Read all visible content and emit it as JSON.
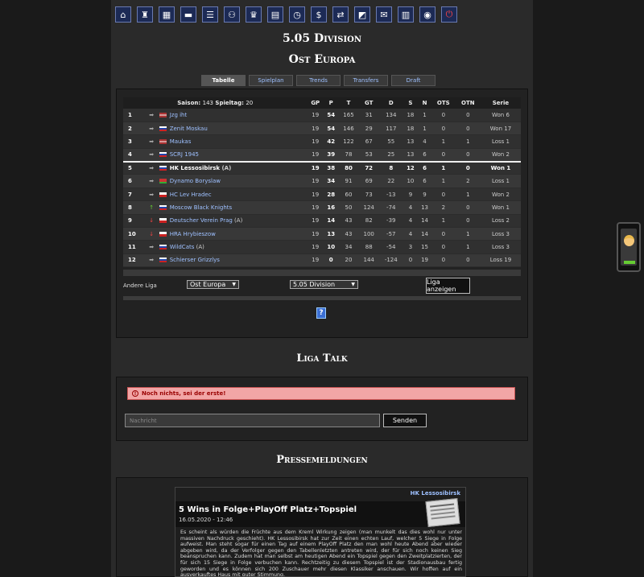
{
  "nav_icons": [
    "home-icon",
    "jersey-icon",
    "lineup-icon",
    "training-icon",
    "list-icon",
    "versus-icon",
    "trophy-icon",
    "arena-icon",
    "clock-icon",
    "finance-icon",
    "transfer-icon",
    "stats-icon",
    "mail-icon",
    "table-icon",
    "chat-icon",
    "logout-icon"
  ],
  "division_title": "5.05 Division",
  "region_title": "Ost Europa",
  "tabs": [
    "Tabelle",
    "Spielplan",
    "Trends",
    "Transfers",
    "Draft"
  ],
  "table": {
    "season_label": "Saison:",
    "season_value": "143",
    "matchday_label": "Spieltag:",
    "matchday_value": "20",
    "columns": [
      "GP",
      "P",
      "T",
      "GT",
      "D",
      "S",
      "N",
      "OTS",
      "OTN",
      "Serie"
    ],
    "rows": [
      {
        "rank": "1",
        "trend": "same",
        "flag": "lv",
        "team": "Jzg iht",
        "suffix": "",
        "gp": "19",
        "p": "54",
        "t": "165",
        "gt": "31",
        "d": "134",
        "s": "18",
        "n": "1",
        "ots": "0",
        "otn": "0",
        "serie": "Won 6"
      },
      {
        "rank": "2",
        "trend": "same",
        "flag": "ru",
        "team": "Zenit Moskau",
        "suffix": "",
        "gp": "19",
        "p": "54",
        "t": "146",
        "gt": "29",
        "d": "117",
        "s": "18",
        "n": "1",
        "ots": "0",
        "otn": "0",
        "serie": "Won 17"
      },
      {
        "rank": "3",
        "trend": "same",
        "flag": "lv",
        "team": "Maukas",
        "suffix": "",
        "gp": "19",
        "p": "42",
        "t": "122",
        "gt": "67",
        "d": "55",
        "s": "13",
        "n": "4",
        "ots": "1",
        "otn": "1",
        "serie": "Loss 1"
      },
      {
        "rank": "4",
        "trend": "same",
        "flag": "ru",
        "team": "SCRJ 1945",
        "suffix": "",
        "gp": "19",
        "p": "39",
        "t": "78",
        "gt": "53",
        "d": "25",
        "s": "13",
        "n": "6",
        "ots": "0",
        "otn": "0",
        "serie": "Won 2"
      },
      {
        "rank": "5",
        "trend": "same",
        "flag": "ru",
        "team": "HK Lessosibirsk",
        "suffix": "(A)",
        "gp": "19",
        "p": "38",
        "t": "80",
        "gt": "72",
        "d": "8",
        "s": "12",
        "n": "6",
        "ots": "1",
        "otn": "0",
        "serie": "Won 1"
      },
      {
        "rank": "6",
        "trend": "same",
        "flag": "by",
        "team": "Dynamo Boryslaw",
        "suffix": "",
        "gp": "19",
        "p": "34",
        "t": "91",
        "gt": "69",
        "d": "22",
        "s": "10",
        "n": "6",
        "ots": "1",
        "otn": "2",
        "serie": "Loss 1"
      },
      {
        "rank": "7",
        "trend": "same",
        "flag": "cz",
        "team": "HC Lev Hradec",
        "suffix": "",
        "gp": "19",
        "p": "28",
        "t": "60",
        "gt": "73",
        "d": "-13",
        "s": "9",
        "n": "9",
        "ots": "0",
        "otn": "1",
        "serie": "Won 2"
      },
      {
        "rank": "8",
        "trend": "up",
        "flag": "ru",
        "team": "Moscow Black Knights",
        "suffix": "",
        "gp": "19",
        "p": "16",
        "t": "50",
        "gt": "124",
        "d": "-74",
        "s": "4",
        "n": "13",
        "ots": "2",
        "otn": "0",
        "serie": "Won 1"
      },
      {
        "rank": "9",
        "trend": "down",
        "flag": "cz",
        "team": "Deutscher Verein Prag",
        "suffix": "(A)",
        "gp": "19",
        "p": "14",
        "t": "43",
        "gt": "82",
        "d": "-39",
        "s": "4",
        "n": "14",
        "ots": "1",
        "otn": "0",
        "serie": "Loss 2"
      },
      {
        "rank": "10",
        "trend": "down",
        "flag": "cz",
        "team": "HRA Hrybieszow",
        "suffix": "",
        "gp": "19",
        "p": "13",
        "t": "43",
        "gt": "100",
        "d": "-57",
        "s": "4",
        "n": "14",
        "ots": "0",
        "otn": "1",
        "serie": "Loss 3"
      },
      {
        "rank": "11",
        "trend": "same",
        "flag": "ru",
        "team": "WildCats",
        "suffix": "(A)",
        "gp": "19",
        "p": "10",
        "t": "34",
        "gt": "88",
        "d": "-54",
        "s": "3",
        "n": "15",
        "ots": "0",
        "otn": "1",
        "serie": "Loss 3"
      },
      {
        "rank": "12",
        "trend": "same",
        "flag": "ru",
        "team": "Schierser Grizzlys",
        "suffix": "",
        "gp": "19",
        "p": "0",
        "t": "20",
        "gt": "144",
        "d": "-124",
        "s": "0",
        "n": "19",
        "ots": "0",
        "otn": "0",
        "serie": "Loss 19"
      }
    ]
  },
  "filter": {
    "label": "Andere Liga",
    "league_value": "Ost Europa",
    "division_value": "5.05 Division",
    "button": "Liga anzeigen"
  },
  "help_label": "?",
  "talk": {
    "title": "Liga Talk",
    "alert": "Noch nichts, sei der erste!",
    "placeholder": "Nachricht",
    "send_button": "Senden"
  },
  "press": {
    "title": "Pressemeldungen",
    "team": "HK Lessosibirsk",
    "headline": "5 Wins in Folge+PlayOff Platz+Topspiel",
    "date": "16.05.2020 - 12:46",
    "body": "Es scheint als würden die Früchte aus dem Kreml Wirkung zeigen (man munkelt das dies wohl nur unter massiven Nachdruck geschieht). HK Lessosibirsk hat zur Zeit einen echten Lauf, welcher 5 Siege in Folge aufweist. Man steht sogar für einen Tag auf einem PlayOff Platz den man wohl heute Abend aber wieder abgeben wird, da der Verfolger gegen den Tabellenletzten antreten wird, der für sich noch keinen Sieg beanspruchen kann. Zudem hat man selbst am heutigen Abend ein Topspiel gegen den Zweitplatzierten, der für sich 15 Siege in Folge verbuchen kann. Rechtzeitig zu diesem Topspiel ist der Stadionausbau fertig geworden und es können sich 200 Zuschauer mehr diesen Klassiker anschauen. Wir hoffen auf ein ausverkauftes Haus mit guter Stimmung."
  },
  "colors": {
    "link": "#9ec0ff",
    "alert_bg": "#f2a6a6",
    "up": "#6c3",
    "down": "#e44"
  }
}
